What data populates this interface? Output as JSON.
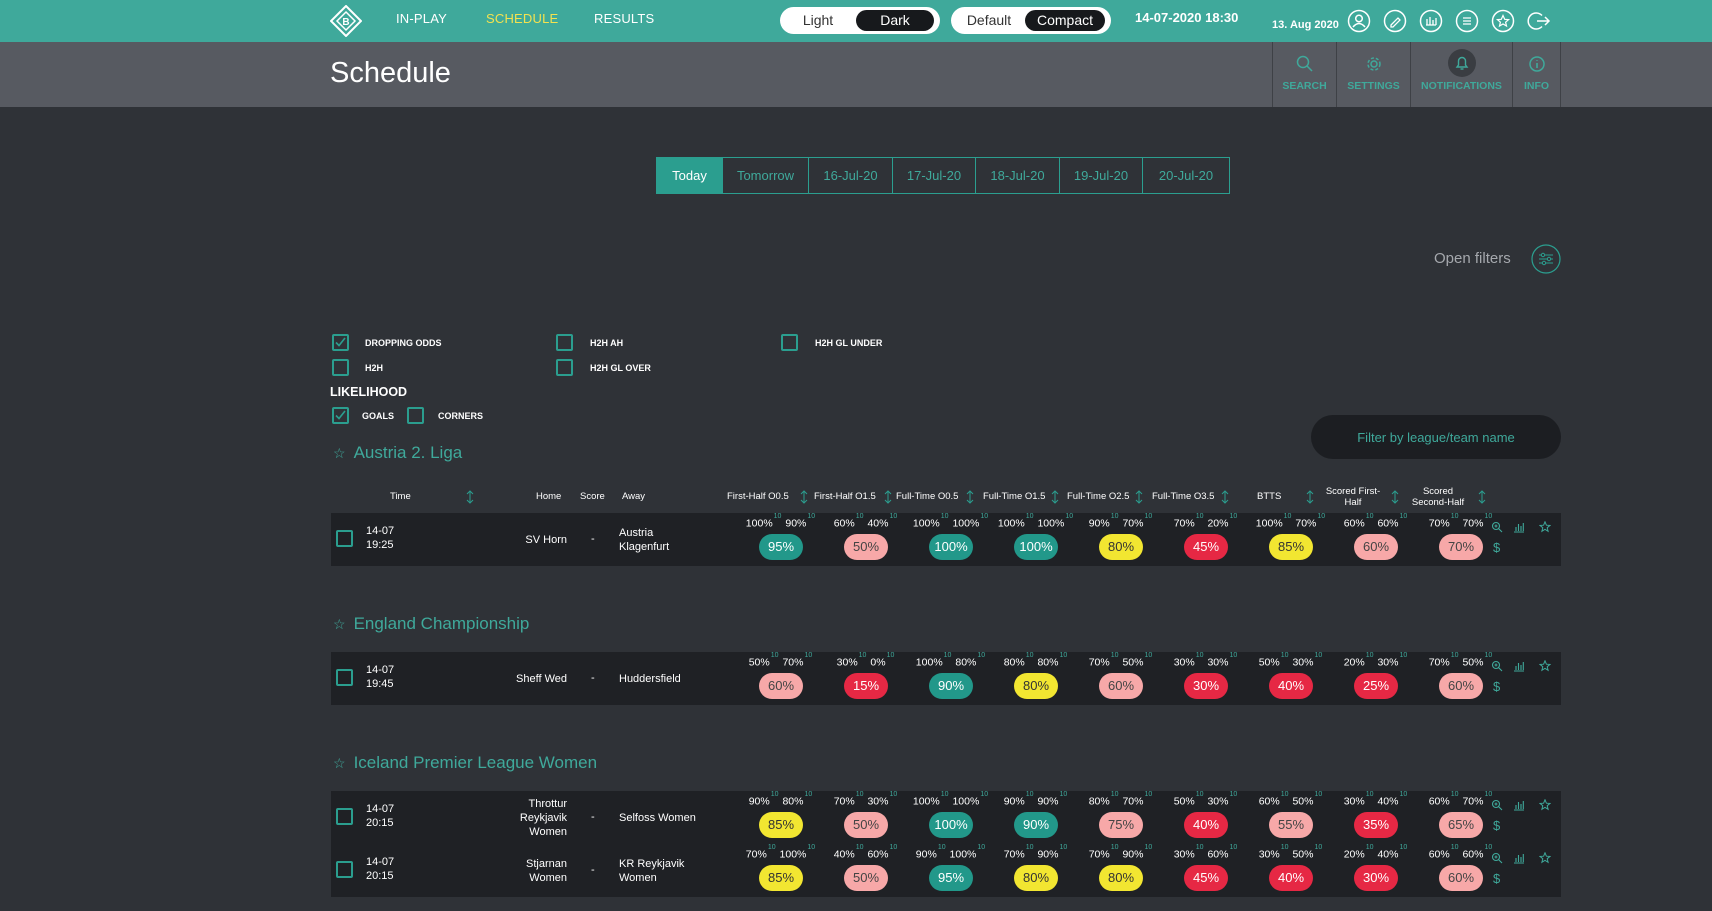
{
  "nav": {
    "inplay": "IN-PLAY",
    "schedule": "SCHEDULE",
    "results": "RESULTS"
  },
  "theme": {
    "light": "Light",
    "dark": "Dark",
    "default": "Default",
    "compact": "Compact"
  },
  "datetime": "14-07-2020 18:30",
  "date_small": "13. Aug 2020",
  "page_title": "Schedule",
  "tools": {
    "search": "SEARCH",
    "settings": "SETTINGS",
    "notifications": "NOTIFICATIONS",
    "info": "INFO"
  },
  "date_tabs": [
    "Today",
    "Tomorrow",
    "16-Jul-20",
    "17-Jul-20",
    "18-Jul-20",
    "19-Jul-20",
    "20-Jul-20"
  ],
  "open_filters": "Open filters",
  "filters": {
    "dropping_odds": "DROPPING ODDS",
    "h2h": "H2H",
    "h2h_ah": "H2H AH",
    "h2h_gl_over": "H2H GL OVER",
    "h2h_gl_under": "H2H GL UNDER",
    "likelihood": "LIKELIHOOD",
    "goals": "GOALS",
    "corners": "CORNERS"
  },
  "filter_states": {
    "dropping_odds": true,
    "h2h": false,
    "h2h_ah": false,
    "h2h_gl_over": false,
    "h2h_gl_under": false,
    "goals": true,
    "corners": false
  },
  "search_placeholder": "Filter by league/team name",
  "columns": {
    "time": "Time",
    "home": "Home",
    "score": "Score",
    "away": "Away",
    "c1": "First-Half O0.5",
    "c2": "First-Half O1.5",
    "c3": "Full-Time O0.5",
    "c4": "Full-Time O1.5",
    "c5": "Full-Time O2.5",
    "c6": "Full-Time O3.5",
    "c7": "BTTS",
    "c8a": "Scored First-",
    "c8b": "Half",
    "c9a": "Scored",
    "c9b": "Second-Half"
  },
  "sup": "10",
  "leagues": [
    {
      "name": "Austria 2. Liga"
    },
    {
      "name": "England Championship"
    },
    {
      "name": "Iceland Premier League Women"
    }
  ],
  "matches": [
    {
      "date": "14-07",
      "time": "19:25",
      "home": [
        "SV Horn"
      ],
      "score": "-",
      "away": [
        "Austria",
        "Klagenfurt"
      ],
      "stats": [
        [
          "100%",
          "90%",
          "95%",
          "t"
        ],
        [
          "60%",
          "40%",
          "50%",
          "p"
        ],
        [
          "100%",
          "100%",
          "100%",
          "t"
        ],
        [
          "100%",
          "100%",
          "100%",
          "t"
        ],
        [
          "90%",
          "70%",
          "80%",
          "y"
        ],
        [
          "70%",
          "20%",
          "45%",
          "r"
        ],
        [
          "100%",
          "70%",
          "85%",
          "y"
        ],
        [
          "60%",
          "60%",
          "60%",
          "p"
        ],
        [
          "70%",
          "70%",
          "70%",
          "p"
        ]
      ]
    },
    {
      "date": "14-07",
      "time": "19:45",
      "home": [
        "Sheff Wed"
      ],
      "score": "-",
      "away": [
        "Huddersfield"
      ],
      "stats": [
        [
          "50%",
          "70%",
          "60%",
          "p"
        ],
        [
          "30%",
          "0%",
          "15%",
          "r"
        ],
        [
          "100%",
          "80%",
          "90%",
          "t"
        ],
        [
          "80%",
          "80%",
          "80%",
          "y"
        ],
        [
          "70%",
          "50%",
          "60%",
          "p"
        ],
        [
          "30%",
          "30%",
          "30%",
          "r"
        ],
        [
          "50%",
          "30%",
          "40%",
          "r"
        ],
        [
          "20%",
          "30%",
          "25%",
          "r"
        ],
        [
          "70%",
          "50%",
          "60%",
          "p"
        ]
      ]
    },
    {
      "date": "14-07",
      "time": "20:15",
      "home": [
        "Throttur",
        "Reykjavik",
        "Women"
      ],
      "score": "-",
      "away": [
        "Selfoss Women"
      ],
      "stats": [
        [
          "90%",
          "80%",
          "85%",
          "y"
        ],
        [
          "70%",
          "30%",
          "50%",
          "p"
        ],
        [
          "100%",
          "100%",
          "100%",
          "t"
        ],
        [
          "90%",
          "90%",
          "90%",
          "t"
        ],
        [
          "80%",
          "70%",
          "75%",
          "p"
        ],
        [
          "50%",
          "30%",
          "40%",
          "r"
        ],
        [
          "60%",
          "50%",
          "55%",
          "p"
        ],
        [
          "30%",
          "40%",
          "35%",
          "r"
        ],
        [
          "60%",
          "70%",
          "65%",
          "p"
        ]
      ]
    },
    {
      "date": "14-07",
      "time": "20:15",
      "home": [
        "Stjarnan",
        "Women"
      ],
      "score": "-",
      "away": [
        "KR Reykjavik",
        "Women"
      ],
      "stats": [
        [
          "70%",
          "100%",
          "85%",
          "y"
        ],
        [
          "40%",
          "60%",
          "50%",
          "p"
        ],
        [
          "90%",
          "100%",
          "95%",
          "t"
        ],
        [
          "70%",
          "90%",
          "80%",
          "y"
        ],
        [
          "70%",
          "90%",
          "80%",
          "y"
        ],
        [
          "30%",
          "60%",
          "45%",
          "r"
        ],
        [
          "30%",
          "50%",
          "40%",
          "r"
        ],
        [
          "20%",
          "40%",
          "30%",
          "r"
        ],
        [
          "60%",
          "60%",
          "60%",
          "p"
        ]
      ]
    }
  ],
  "currency_icon": "$",
  "colors": {
    "accent": "#3fa99b",
    "topbar": "#3fa99b",
    "teal": "#22988a",
    "yellow": "#f2e631",
    "pink": "#f7a8a8",
    "red": "#e62844",
    "active_nav": "#f3e24f"
  }
}
